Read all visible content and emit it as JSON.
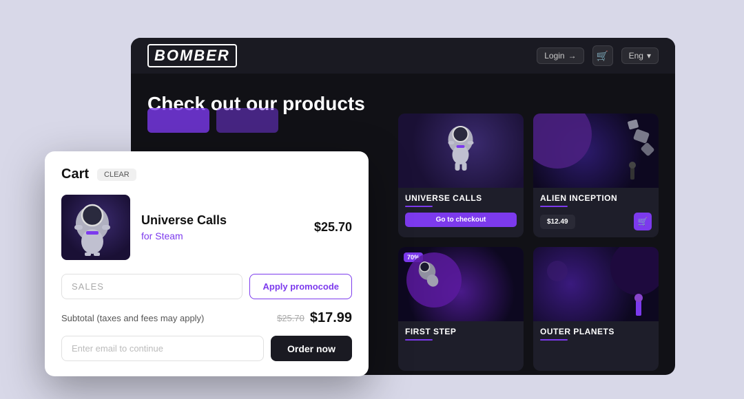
{
  "app": {
    "logo": "BOMBER",
    "header": {
      "login_label": "Login",
      "lang_label": "Eng"
    },
    "page_title": "Check out our products"
  },
  "products": [
    {
      "id": "universe-calls",
      "name": "UNIVERSE CALLS",
      "action": "checkout",
      "action_label": "Go to checkout",
      "theme": "universe"
    },
    {
      "id": "alien-inception",
      "name": "ALIEN INCEPTION",
      "action": "price",
      "price": "$12.49",
      "theme": "alien"
    },
    {
      "id": "first-step",
      "name": "FIRST STEP",
      "action": "cart",
      "badge": "70%",
      "theme": "firststep"
    },
    {
      "id": "outer-planets",
      "name": "OUTER PLANETS",
      "action": "cart",
      "theme": "outerplanets"
    }
  ],
  "cart": {
    "title": "Cart",
    "clear_label": "CLEAR",
    "item": {
      "name": "Universe Calls",
      "platform": "for Steam",
      "price": "$25.70"
    },
    "promo": {
      "placeholder": "SALES",
      "apply_label": "Apply promocode"
    },
    "subtotal": {
      "label": "Subtotal (taxes and fees may apply)",
      "old_price": "$25.70",
      "new_price": "$17.99"
    },
    "email_placeholder": "Enter email to continue",
    "order_label": "Order now"
  }
}
